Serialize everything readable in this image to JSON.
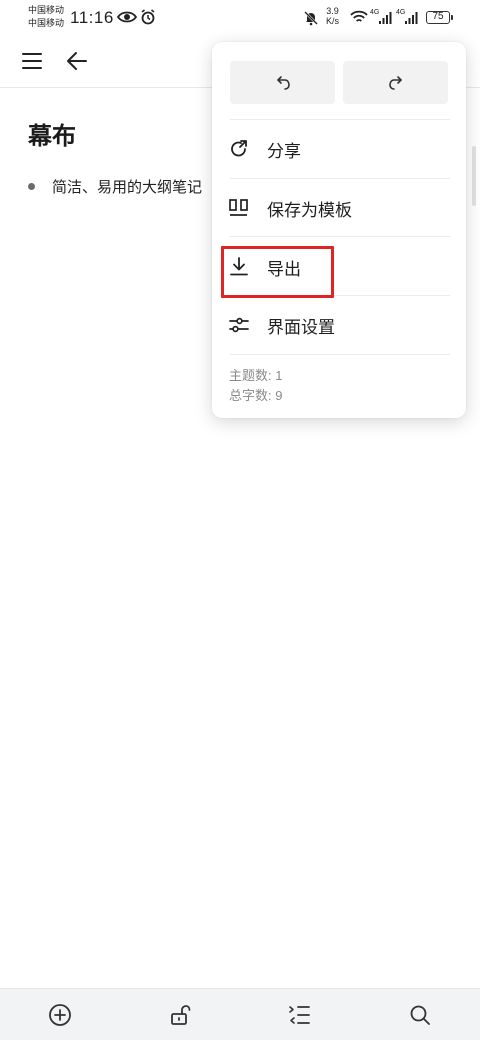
{
  "status_bar": {
    "carrier_1": "中国移动",
    "carrier_2": "中国移动",
    "time": "11:16",
    "net_speed_value": "3.9",
    "net_speed_unit": "K/s",
    "signal_1": "4G",
    "signal_2": "4G",
    "battery": "75"
  },
  "document": {
    "title": "幕布",
    "items": [
      {
        "text": "简洁、易用的大纲笔记"
      }
    ]
  },
  "menu": {
    "items": [
      {
        "label": "分享",
        "icon": "share-icon"
      },
      {
        "label": "保存为模板",
        "icon": "template-icon"
      },
      {
        "label": "导出",
        "icon": "download-icon"
      },
      {
        "label": "界面设置",
        "icon": "sliders-icon"
      }
    ],
    "stats": {
      "topics": "主题数: 1",
      "words": "总字数: 9"
    }
  },
  "colors": {
    "highlight": "#e02424",
    "bottom_bar": "#f2f3f5",
    "undo_redo_bg": "#f2f2f2"
  }
}
